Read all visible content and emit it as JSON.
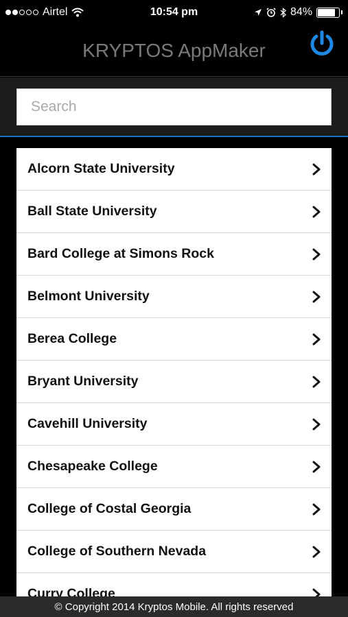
{
  "status_bar": {
    "carrier": "Airtel",
    "time": "10:54 pm",
    "battery": "84%",
    "battery_level": 0.84
  },
  "header": {
    "title": "KRYPTOS AppMaker",
    "power_icon": "power-icon",
    "accent": "#1e88e5"
  },
  "search": {
    "placeholder": "Search",
    "value": ""
  },
  "list": {
    "items": [
      {
        "label": "Alcorn State University"
      },
      {
        "label": "Ball State University"
      },
      {
        "label": "Bard College at Simons Rock"
      },
      {
        "label": "Belmont University"
      },
      {
        "label": "Berea College"
      },
      {
        "label": "Bryant University"
      },
      {
        "label": "Cavehill University"
      },
      {
        "label": "Chesapeake College"
      },
      {
        "label": "College of Costal Georgia"
      },
      {
        "label": "College of Southern Nevada"
      },
      {
        "label": "Curry College"
      }
    ]
  },
  "footer": {
    "text": "© Copyright 2014 Kryptos Mobile. All rights reserved"
  }
}
